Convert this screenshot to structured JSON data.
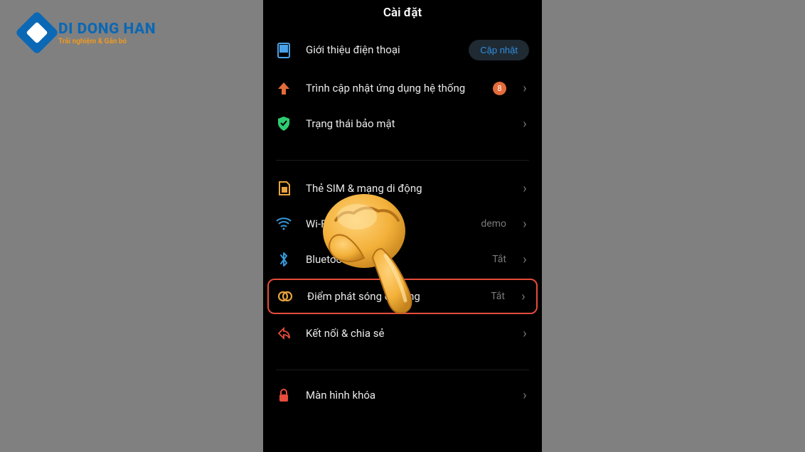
{
  "watermark": {
    "brand": "DI DONG HAN",
    "tagline": "Trải nghiệm & Gắn bó"
  },
  "header": {
    "title": "Cài đặt"
  },
  "rows": {
    "about": {
      "label": "Giới thiệu điện thoại",
      "action": "Cập nhật"
    },
    "updater": {
      "label": "Trình cập nhật ứng dụng hệ thống",
      "badge": "8"
    },
    "security": {
      "label": "Trạng thái bảo mật"
    },
    "sim": {
      "label": "Thẻ SIM & mạng di động"
    },
    "wifi": {
      "label": "Wi-Fi",
      "value": "demo"
    },
    "bluetooth": {
      "label": "Bluetooth",
      "value": "Tắt"
    },
    "hotspot": {
      "label": "Điểm phát sóng di động",
      "value": "Tắt"
    },
    "share": {
      "label": "Kết nối & chia sẻ"
    },
    "lock": {
      "label": "Màn hình khóa"
    }
  }
}
